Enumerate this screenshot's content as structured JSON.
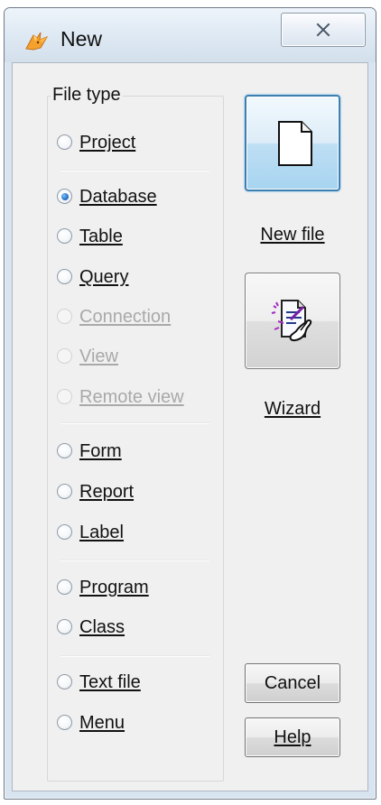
{
  "window": {
    "title": "New",
    "close_glyph": "✕"
  },
  "file_type_group": {
    "label": "File type",
    "options": [
      {
        "label": "Project",
        "checked": false,
        "enabled": true
      },
      {
        "label": "Database",
        "checked": true,
        "enabled": true
      },
      {
        "label": "Table",
        "checked": false,
        "enabled": true
      },
      {
        "label": "Query",
        "checked": false,
        "enabled": true
      },
      {
        "label": "Connection",
        "checked": false,
        "enabled": false
      },
      {
        "label": "View",
        "checked": false,
        "enabled": false
      },
      {
        "label": "Remote view",
        "checked": false,
        "enabled": false
      },
      {
        "label": "Form",
        "checked": false,
        "enabled": true
      },
      {
        "label": "Report",
        "checked": false,
        "enabled": true
      },
      {
        "label": "Label",
        "checked": false,
        "enabled": true
      },
      {
        "label": "Program",
        "checked": false,
        "enabled": true
      },
      {
        "label": "Class",
        "checked": false,
        "enabled": true
      },
      {
        "label": "Text file",
        "checked": false,
        "enabled": true
      },
      {
        "label": "Menu",
        "checked": false,
        "enabled": true
      }
    ]
  },
  "actions": {
    "new_file_label": "New file",
    "wizard_label": "Wizard",
    "cancel_label": "Cancel",
    "help_label": "Help"
  },
  "icons": {
    "app": "fox-icon",
    "new_file": "new-file-page-icon",
    "wizard": "wizard-magic-icon",
    "close": "close-icon"
  }
}
